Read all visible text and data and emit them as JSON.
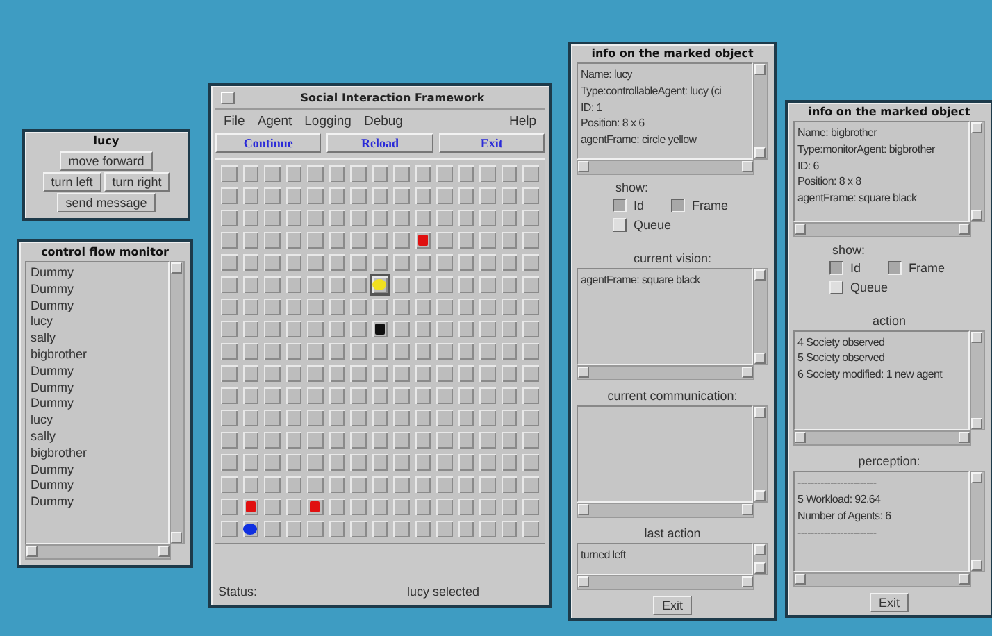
{
  "control_window": {
    "title": "lucy",
    "button_rows": [
      [
        "move forward"
      ],
      [
        "turn left",
        "turn right"
      ],
      [
        "send message"
      ]
    ]
  },
  "control_flow_monitor": {
    "title": "control flow monitor",
    "items": [
      "Dummy",
      "Dummy",
      "Dummy",
      "lucy",
      "sally",
      "bigbrother",
      "Dummy",
      "Dummy",
      "Dummy",
      "lucy",
      "sally",
      "bigbrother",
      "Dummy",
      "Dummy",
      "Dummy"
    ]
  },
  "main_window": {
    "title": "Social Interaction Framework",
    "menu": [
      "File",
      "Agent",
      "Logging",
      "Debug"
    ],
    "help_menu": "Help",
    "buttons": [
      "Continue",
      "Reload",
      "Exit"
    ],
    "grid": {
      "rows": [
        [
          {
            "kind": "empty"
          },
          {
            "kind": "empty"
          },
          {
            "kind": "empty"
          },
          {
            "kind": "empty"
          },
          {
            "kind": "empty"
          },
          {
            "kind": "empty"
          },
          {
            "kind": "empty"
          },
          {
            "kind": "empty"
          },
          {
            "kind": "empty"
          },
          {
            "kind": "empty"
          },
          {
            "kind": "empty"
          },
          {
            "kind": "empty"
          },
          {
            "kind": "empty"
          },
          {
            "kind": "empty"
          },
          {
            "kind": "empty"
          }
        ],
        [
          {
            "kind": "empty"
          },
          {
            "kind": "empty"
          },
          {
            "kind": "empty"
          },
          {
            "kind": "empty"
          },
          {
            "kind": "empty"
          },
          {
            "kind": "empty"
          },
          {
            "kind": "empty"
          },
          {
            "kind": "empty"
          },
          {
            "kind": "empty"
          },
          {
            "kind": "empty"
          },
          {
            "kind": "empty"
          },
          {
            "kind": "empty"
          },
          {
            "kind": "empty"
          },
          {
            "kind": "empty"
          },
          {
            "kind": "empty"
          }
        ],
        [
          {
            "kind": "empty"
          },
          {
            "kind": "empty"
          },
          {
            "kind": "empty"
          },
          {
            "kind": "empty"
          },
          {
            "kind": "empty"
          },
          {
            "kind": "empty"
          },
          {
            "kind": "empty"
          },
          {
            "kind": "empty"
          },
          {
            "kind": "empty"
          },
          {
            "kind": "empty"
          },
          {
            "kind": "empty"
          },
          {
            "kind": "empty"
          },
          {
            "kind": "empty"
          },
          {
            "kind": "empty"
          },
          {
            "kind": "empty"
          }
        ],
        [
          {
            "kind": "empty"
          },
          {
            "kind": "empty"
          },
          {
            "kind": "empty"
          },
          {
            "kind": "empty"
          },
          {
            "kind": "empty"
          },
          {
            "kind": "empty"
          },
          {
            "kind": "empty"
          },
          {
            "kind": "empty"
          },
          {
            "kind": "empty"
          },
          {
            "kind": "square",
            "color": "#e01010",
            "selected": false
          },
          {
            "kind": "empty"
          },
          {
            "kind": "empty"
          },
          {
            "kind": "empty"
          },
          {
            "kind": "empty"
          },
          {
            "kind": "empty"
          }
        ],
        [
          {
            "kind": "empty"
          },
          {
            "kind": "empty"
          },
          {
            "kind": "empty"
          },
          {
            "kind": "empty"
          },
          {
            "kind": "empty"
          },
          {
            "kind": "empty"
          },
          {
            "kind": "empty"
          },
          {
            "kind": "empty"
          },
          {
            "kind": "empty"
          },
          {
            "kind": "empty"
          },
          {
            "kind": "empty"
          },
          {
            "kind": "empty"
          },
          {
            "kind": "empty"
          },
          {
            "kind": "empty"
          },
          {
            "kind": "empty"
          }
        ],
        [
          {
            "kind": "empty"
          },
          {
            "kind": "empty"
          },
          {
            "kind": "empty"
          },
          {
            "kind": "empty"
          },
          {
            "kind": "empty"
          },
          {
            "kind": "empty"
          },
          {
            "kind": "empty"
          },
          {
            "kind": "circle",
            "color": "#f0e020",
            "selected": true
          },
          {
            "kind": "empty"
          },
          {
            "kind": "empty"
          },
          {
            "kind": "empty"
          },
          {
            "kind": "empty"
          },
          {
            "kind": "empty"
          },
          {
            "kind": "empty"
          },
          {
            "kind": "empty"
          }
        ],
        [
          {
            "kind": "empty"
          },
          {
            "kind": "empty"
          },
          {
            "kind": "empty"
          },
          {
            "kind": "empty"
          },
          {
            "kind": "empty"
          },
          {
            "kind": "empty"
          },
          {
            "kind": "empty"
          },
          {
            "kind": "empty"
          },
          {
            "kind": "empty"
          },
          {
            "kind": "empty"
          },
          {
            "kind": "empty"
          },
          {
            "kind": "empty"
          },
          {
            "kind": "empty"
          },
          {
            "kind": "empty"
          },
          {
            "kind": "empty"
          }
        ],
        [
          {
            "kind": "empty"
          },
          {
            "kind": "empty"
          },
          {
            "kind": "empty"
          },
          {
            "kind": "empty"
          },
          {
            "kind": "empty"
          },
          {
            "kind": "empty"
          },
          {
            "kind": "empty"
          },
          {
            "kind": "square",
            "color": "#101010",
            "selected": false
          },
          {
            "kind": "empty"
          },
          {
            "kind": "empty"
          },
          {
            "kind": "empty"
          },
          {
            "kind": "empty"
          },
          {
            "kind": "empty"
          },
          {
            "kind": "empty"
          },
          {
            "kind": "empty"
          }
        ],
        [
          {
            "kind": "empty"
          },
          {
            "kind": "empty"
          },
          {
            "kind": "empty"
          },
          {
            "kind": "empty"
          },
          {
            "kind": "empty"
          },
          {
            "kind": "empty"
          },
          {
            "kind": "empty"
          },
          {
            "kind": "empty"
          },
          {
            "kind": "empty"
          },
          {
            "kind": "empty"
          },
          {
            "kind": "empty"
          },
          {
            "kind": "empty"
          },
          {
            "kind": "empty"
          },
          {
            "kind": "empty"
          },
          {
            "kind": "empty"
          }
        ],
        [
          {
            "kind": "empty"
          },
          {
            "kind": "empty"
          },
          {
            "kind": "empty"
          },
          {
            "kind": "empty"
          },
          {
            "kind": "empty"
          },
          {
            "kind": "empty"
          },
          {
            "kind": "empty"
          },
          {
            "kind": "empty"
          },
          {
            "kind": "empty"
          },
          {
            "kind": "empty"
          },
          {
            "kind": "empty"
          },
          {
            "kind": "empty"
          },
          {
            "kind": "empty"
          },
          {
            "kind": "empty"
          },
          {
            "kind": "empty"
          }
        ],
        [
          {
            "kind": "empty"
          },
          {
            "kind": "empty"
          },
          {
            "kind": "empty"
          },
          {
            "kind": "empty"
          },
          {
            "kind": "empty"
          },
          {
            "kind": "empty"
          },
          {
            "kind": "empty"
          },
          {
            "kind": "empty"
          },
          {
            "kind": "empty"
          },
          {
            "kind": "empty"
          },
          {
            "kind": "empty"
          },
          {
            "kind": "empty"
          },
          {
            "kind": "empty"
          },
          {
            "kind": "empty"
          },
          {
            "kind": "empty"
          }
        ],
        [
          {
            "kind": "empty"
          },
          {
            "kind": "empty"
          },
          {
            "kind": "empty"
          },
          {
            "kind": "empty"
          },
          {
            "kind": "empty"
          },
          {
            "kind": "empty"
          },
          {
            "kind": "empty"
          },
          {
            "kind": "empty"
          },
          {
            "kind": "empty"
          },
          {
            "kind": "empty"
          },
          {
            "kind": "empty"
          },
          {
            "kind": "empty"
          },
          {
            "kind": "empty"
          },
          {
            "kind": "empty"
          },
          {
            "kind": "empty"
          }
        ],
        [
          {
            "kind": "empty"
          },
          {
            "kind": "empty"
          },
          {
            "kind": "empty"
          },
          {
            "kind": "empty"
          },
          {
            "kind": "empty"
          },
          {
            "kind": "empty"
          },
          {
            "kind": "empty"
          },
          {
            "kind": "empty"
          },
          {
            "kind": "empty"
          },
          {
            "kind": "empty"
          },
          {
            "kind": "empty"
          },
          {
            "kind": "empty"
          },
          {
            "kind": "empty"
          },
          {
            "kind": "empty"
          },
          {
            "kind": "empty"
          }
        ],
        [
          {
            "kind": "empty"
          },
          {
            "kind": "empty"
          },
          {
            "kind": "empty"
          },
          {
            "kind": "empty"
          },
          {
            "kind": "empty"
          },
          {
            "kind": "empty"
          },
          {
            "kind": "empty"
          },
          {
            "kind": "empty"
          },
          {
            "kind": "empty"
          },
          {
            "kind": "empty"
          },
          {
            "kind": "empty"
          },
          {
            "kind": "empty"
          },
          {
            "kind": "empty"
          },
          {
            "kind": "empty"
          },
          {
            "kind": "empty"
          }
        ],
        [
          {
            "kind": "empty"
          },
          {
            "kind": "empty"
          },
          {
            "kind": "empty"
          },
          {
            "kind": "empty"
          },
          {
            "kind": "empty"
          },
          {
            "kind": "empty"
          },
          {
            "kind": "empty"
          },
          {
            "kind": "empty"
          },
          {
            "kind": "empty"
          },
          {
            "kind": "empty"
          },
          {
            "kind": "empty"
          },
          {
            "kind": "empty"
          },
          {
            "kind": "empty"
          },
          {
            "kind": "empty"
          },
          {
            "kind": "empty"
          }
        ],
        [
          {
            "kind": "empty"
          },
          {
            "kind": "square",
            "color": "#e01010",
            "selected": false
          },
          {
            "kind": "empty"
          },
          {
            "kind": "empty"
          },
          {
            "kind": "square",
            "color": "#e01010",
            "selected": false
          },
          {
            "kind": "empty"
          },
          {
            "kind": "empty"
          },
          {
            "kind": "empty"
          },
          {
            "kind": "empty"
          },
          {
            "kind": "empty"
          },
          {
            "kind": "empty"
          },
          {
            "kind": "empty"
          },
          {
            "kind": "empty"
          },
          {
            "kind": "empty"
          },
          {
            "kind": "empty"
          }
        ],
        [
          {
            "kind": "empty"
          },
          {
            "kind": "circle",
            "color": "#1030e0",
            "selected": false
          },
          {
            "kind": "empty"
          },
          {
            "kind": "empty"
          },
          {
            "kind": "empty"
          },
          {
            "kind": "empty"
          },
          {
            "kind": "empty"
          },
          {
            "kind": "empty"
          },
          {
            "kind": "empty"
          },
          {
            "kind": "empty"
          },
          {
            "kind": "empty"
          },
          {
            "kind": "empty"
          },
          {
            "kind": "empty"
          },
          {
            "kind": "empty"
          },
          {
            "kind": "empty"
          }
        ]
      ]
    },
    "status_label": "Status:",
    "status_text": "lucy selected"
  },
  "info_windows": [
    {
      "title": "info on the marked object",
      "sections": [
        {
          "kind": "pane",
          "lines": [
            "Name: lucy",
            "Type:controllableAgent: lucy (ci",
            "ID: 1",
            "Position: 8 x 6",
            "agentFrame: circle yellow"
          ]
        },
        {
          "kind": "show",
          "label": "show:",
          "options": [
            {
              "label": "Id",
              "checked": true
            },
            {
              "label": "Frame",
              "checked": true
            },
            {
              "label": "Queue",
              "checked": false
            }
          ]
        },
        {
          "kind": "pane",
          "label": "current vision:",
          "lines": [
            "agentFrame: square black"
          ]
        },
        {
          "kind": "pane",
          "label": "current communication:"
        },
        {
          "kind": "short_pane",
          "label": "last action",
          "lines": [
            "turned left"
          ]
        }
      ],
      "exit_button": "Exit"
    },
    {
      "title": "info on the marked object",
      "sections": [
        {
          "kind": "pane",
          "lines": [
            "Name: bigbrother",
            "Type:monitorAgent: bigbrother",
            "ID: 6",
            "Position: 8 x 8",
            "agentFrame: square black"
          ]
        },
        {
          "kind": "show",
          "label": "show:",
          "options": [
            {
              "label": "Id",
              "checked": true
            },
            {
              "label": "Frame",
              "checked": true
            },
            {
              "label": "Queue",
              "checked": false
            }
          ]
        },
        {
          "kind": "pane",
          "label": "action",
          "lines": [
            "4 Society observed",
            "5 Society observed",
            "6 Society modified: 1 new agent"
          ]
        },
        {
          "kind": "pane",
          "label": "perception:",
          "lines": [
            "------------------------",
            "5 Workload: 92.64",
            " Number of Agents: 6",
            "------------------------"
          ]
        }
      ],
      "exit_button": "Exit"
    }
  ]
}
